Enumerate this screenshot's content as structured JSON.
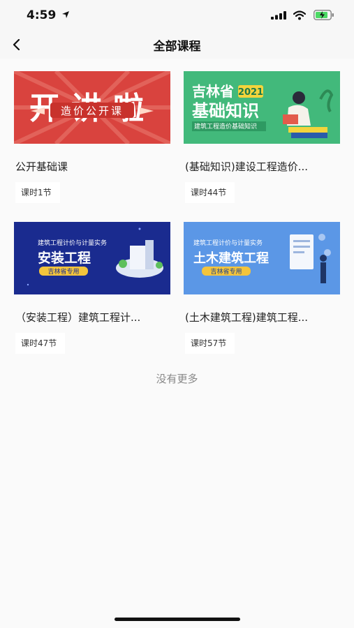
{
  "status_bar": {
    "time": "4:59"
  },
  "header": {
    "title": "全部课程"
  },
  "courses": [
    {
      "title": "公开基础课",
      "lessons": "课时1节",
      "thumb": {
        "big": "开讲啦",
        "small": "造价公开课"
      }
    },
    {
      "title": "(基础知识)建设工程造价...",
      "lessons": "课时44节",
      "thumb": {
        "line1": "吉林省",
        "year": "2021",
        "line2": "基础知识",
        "line3": "建筑工程造价基础知识"
      }
    },
    {
      "title": "（安装工程）建筑工程计...",
      "lessons": "课时47节",
      "thumb": {
        "line1": "建筑工程计价与计量实务",
        "line2": "安装工程",
        "line3": "吉林省专用"
      }
    },
    {
      "title": "(土木建筑工程)建筑工程...",
      "lessons": "课时57节",
      "thumb": {
        "line1": "建筑工程计价与计量实务",
        "line2": "土木建筑工程",
        "line3": "吉林省专用"
      }
    }
  ],
  "footer_text": "没有更多"
}
